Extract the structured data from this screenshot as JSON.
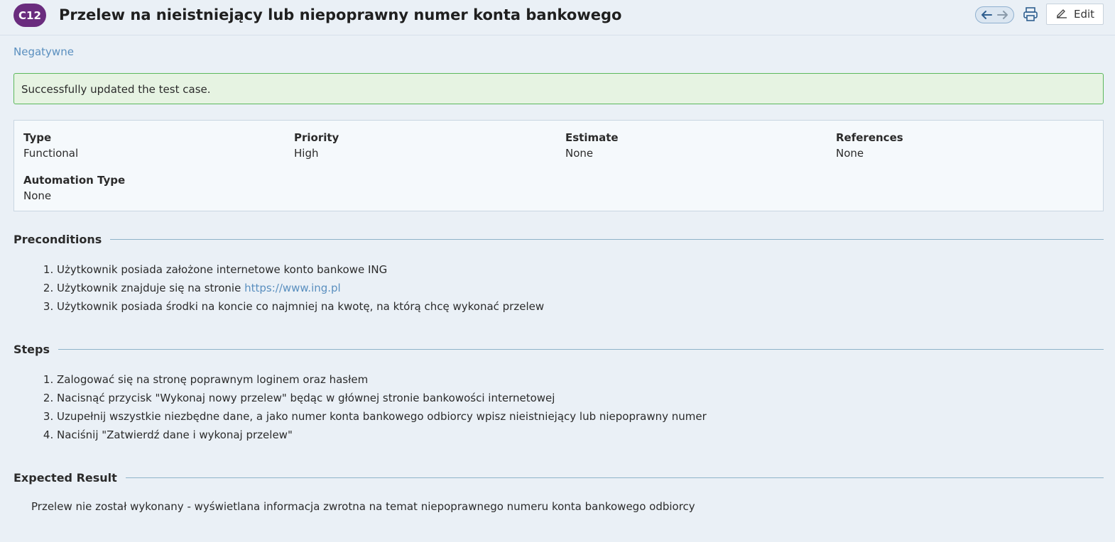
{
  "header": {
    "case_id": "C12",
    "title": "Przelew na nieistniejący lub niepoprawny numer konta bankowego",
    "edit_label": "Edit"
  },
  "section": "Negatywne",
  "alert": "Successfully updated the test case.",
  "properties": [
    {
      "label": "Type",
      "value": "Functional"
    },
    {
      "label": "Priority",
      "value": "High"
    },
    {
      "label": "Estimate",
      "value": "None"
    },
    {
      "label": "References",
      "value": "None"
    },
    {
      "label": "Automation Type",
      "value": "None"
    }
  ],
  "preconditions": {
    "heading": "Preconditions",
    "items": [
      "Użytkownik posiada założone internetowe konto bankowe ING",
      "Użytkownik znajduje się na stronie ",
      "Użytkownik posiada środki na koncie co najmniej na kwotę, na którą chcę wykonać przelew"
    ],
    "link": "https://www.ing.pl"
  },
  "steps": {
    "heading": "Steps",
    "items": [
      "Zalogować się na stronę poprawnym loginem oraz hasłem",
      "Nacisnąć przycisk \"Wykonaj nowy przelew\" będąc w głównej stronie bankowości internetowej",
      "Uzupełnij wszystkie niezbędne dane, a jako numer konta bankowego odbiorcy wpisz nieistniejący lub niepoprawny numer",
      "Naciśnij \"Zatwierdź dane i wykonaj przelew\""
    ]
  },
  "expected": {
    "heading": "Expected Result",
    "text": "Przelew nie został wykonany - wyświetlana informacja zwrotna na temat niepoprawnego numeru konta bankowego odbiorcy"
  },
  "icons": [
    "arrow-left-icon",
    "arrow-right-icon",
    "print-icon",
    "pencil-icon"
  ],
  "colors": {
    "badge": "#6a2c7e",
    "link": "#5a8fbf",
    "alert_bg": "#e6f3e2",
    "alert_border": "#5cb85c"
  }
}
